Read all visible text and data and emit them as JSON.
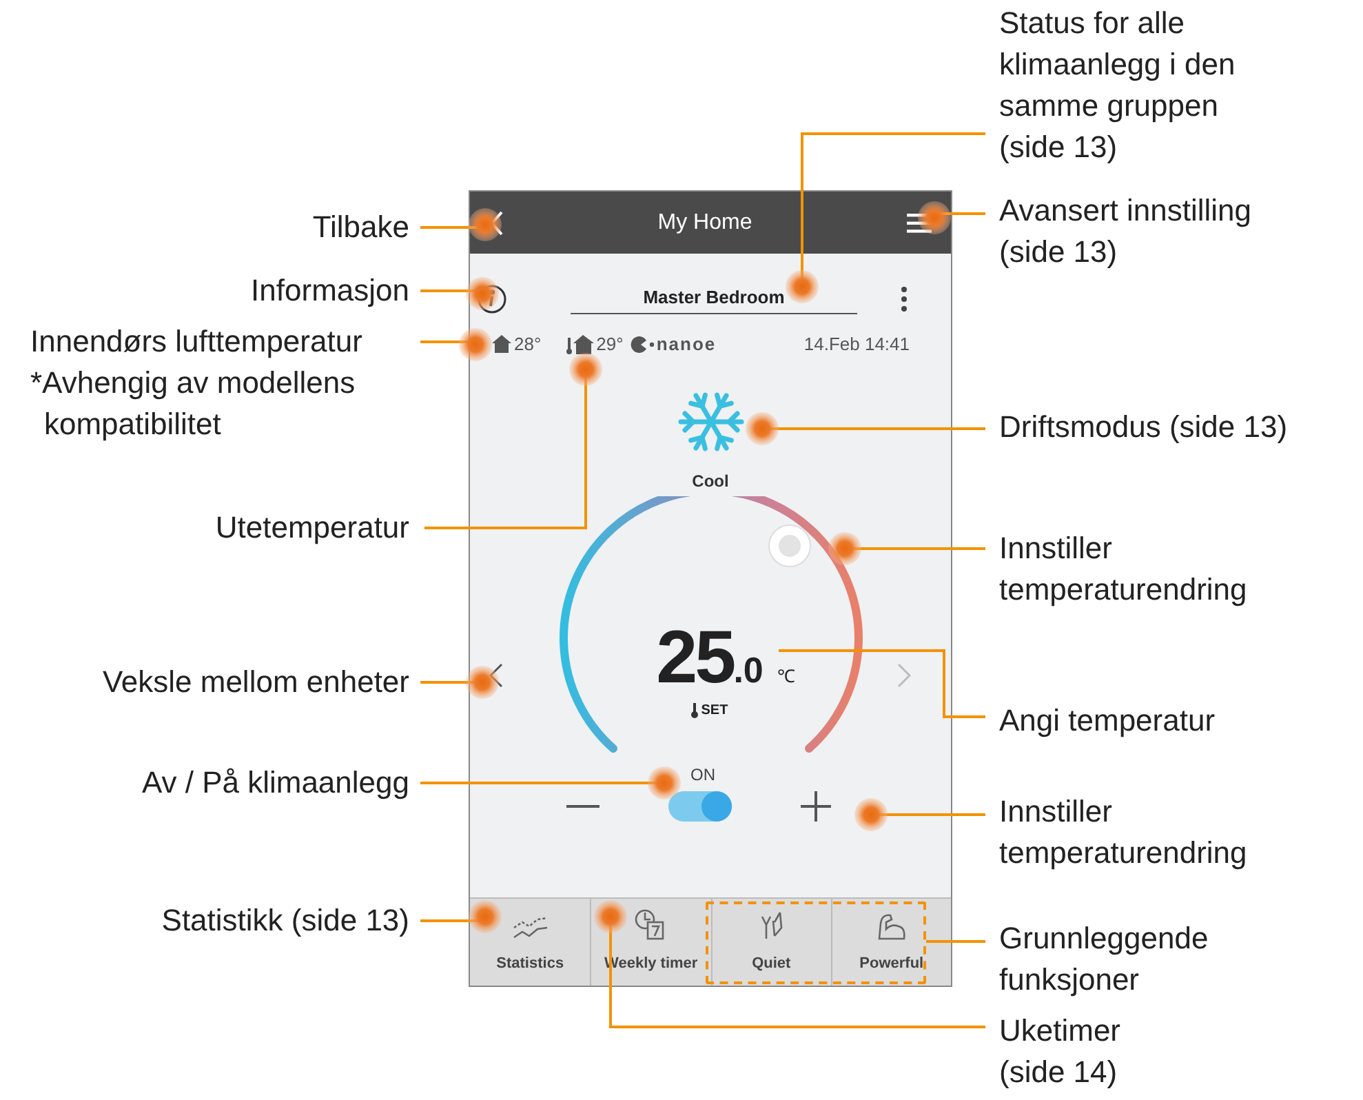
{
  "screen": {
    "header": {
      "title": "My Home"
    },
    "room": "Master Bedroom",
    "indoor_temp": "28°",
    "outdoor_temp": "29°",
    "brand": "nanoe",
    "datetime": "14.Feb 14:41",
    "mode": {
      "kind": "cool",
      "label": "Cool"
    },
    "set_temp": {
      "whole": "25",
      "decimal": ".0",
      "unit": "℃",
      "label": "SET"
    },
    "power": {
      "label": "ON",
      "on": true
    },
    "tabs": [
      {
        "kind": "statistics",
        "label": "Statistics"
      },
      {
        "kind": "timer",
        "label": "Weekly timer"
      },
      {
        "kind": "quiet",
        "label": "Quiet"
      },
      {
        "kind": "powerful",
        "label": "Powerful"
      }
    ]
  },
  "annotations": [
    {
      "lines": [
        "Tilbake"
      ]
    },
    {
      "lines": [
        "Informasjon"
      ]
    },
    {
      "lines": [
        "Innendørs lufttemperatur",
        "*Avhengig av modellens",
        "kompatibilitet"
      ]
    },
    {
      "lines": [
        "Utetemperatur"
      ]
    },
    {
      "lines": [
        "Veksle mellom enheter"
      ]
    },
    {
      "lines": [
        "Av / På klimaanlegg"
      ]
    },
    {
      "lines": [
        "Statistikk (side 13)"
      ]
    },
    {
      "lines": [
        "Status for alle",
        "klimaanlegg i den",
        "samme gruppen",
        "(side 13)"
      ]
    },
    {
      "lines": [
        "Avansert innstilling",
        "(side 13)"
      ]
    },
    {
      "lines": [
        "Driftsmodus (side 13)"
      ]
    },
    {
      "lines": [
        "Innstiller",
        "temperaturendring"
      ]
    },
    {
      "lines": [
        "Angi temperatur"
      ]
    },
    {
      "lines": [
        "Innstiller",
        "temperaturendring"
      ]
    },
    {
      "lines": [
        "Grunnleggende",
        "funksjoner"
      ]
    },
    {
      "lines": [
        "Uketimer",
        "(side 14)"
      ]
    }
  ]
}
